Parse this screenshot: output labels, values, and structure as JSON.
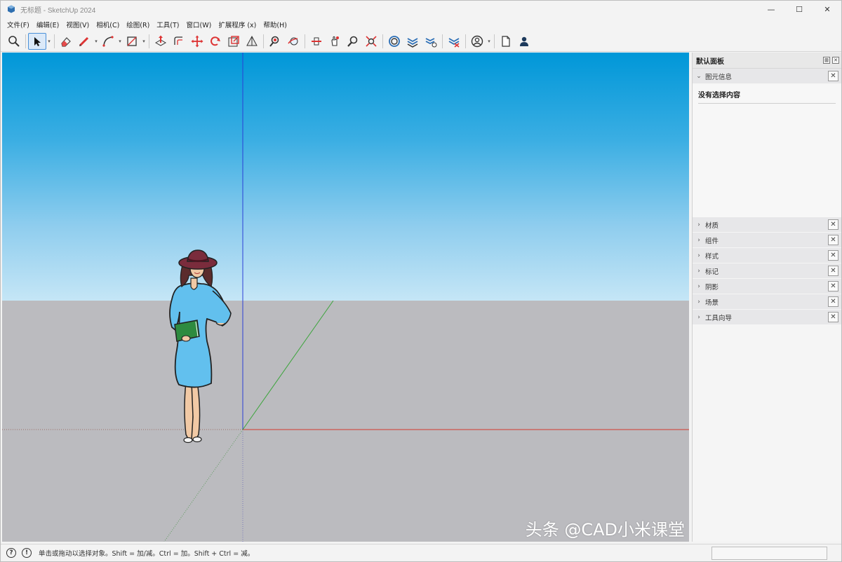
{
  "window": {
    "title": "无标题 - SketchUp 2024",
    "minimize_glyph": "—",
    "maximize_glyph": "☐",
    "close_glyph": "✕"
  },
  "menu": {
    "items": [
      "文件(F)",
      "编辑(E)",
      "视图(V)",
      "相机(C)",
      "绘图(R)",
      "工具(T)",
      "窗口(W)",
      "扩展程序 (x)",
      "帮助(H)"
    ]
  },
  "toolbar": {
    "tools": [
      {
        "name": "search-tool",
        "icon": "magnifier-icon"
      },
      {
        "name": "select-tool",
        "icon": "arrow-cursor-icon",
        "active": true
      },
      {
        "name": "eraser-tool",
        "icon": "eraser-icon"
      },
      {
        "name": "pencil-tool",
        "icon": "pencil-icon"
      },
      {
        "name": "arc-tool",
        "icon": "arc-icon"
      },
      {
        "name": "rectangle-tool",
        "icon": "rectangle-icon"
      },
      {
        "name": "push-pull-tool",
        "icon": "push-pull-icon"
      },
      {
        "name": "offset-tool",
        "icon": "offset-icon"
      },
      {
        "name": "move-tool",
        "icon": "move-icon"
      },
      {
        "name": "rotate-tool",
        "icon": "rotate-icon"
      },
      {
        "name": "scale-tool",
        "icon": "scale-icon"
      },
      {
        "name": "tape-measure-tool",
        "icon": "tape-icon"
      },
      {
        "name": "paint-bucket-tool",
        "icon": "paint-bucket-icon"
      },
      {
        "name": "orbit-tool",
        "icon": "orbit-icon"
      },
      {
        "name": "pan-tool",
        "icon": "pan-icon"
      },
      {
        "name": "zoom-tool",
        "icon": "zoom-icon"
      },
      {
        "name": "zoom-extents-tool",
        "icon": "zoom-extents-icon"
      },
      {
        "name": "warehouse-button",
        "icon": "warehouse-icon"
      },
      {
        "name": "extension-button-1",
        "icon": "layers-icon"
      },
      {
        "name": "extension-button-2",
        "icon": "layers-share-icon"
      },
      {
        "name": "extension-button-3",
        "icon": "layers-x-icon"
      },
      {
        "name": "account-button",
        "icon": "user-circle-icon"
      },
      {
        "name": "new-file-button",
        "icon": "document-icon"
      },
      {
        "name": "profile-button",
        "icon": "person-icon"
      }
    ]
  },
  "panel": {
    "title": "默认面板",
    "entity_info": {
      "label": "图元信息",
      "empty_text": "没有选择内容"
    },
    "sections": [
      "材质",
      "组件",
      "样式",
      "标记",
      "阴影",
      "场景",
      "工具向导"
    ]
  },
  "status": {
    "hint": "单击或拖动以选择对象。Shift = 加/减。Ctrl = 加。Shift + Ctrl = 减。"
  },
  "watermark": "头条 @CAD小米课堂",
  "colors": {
    "sky_top": "#0097d8",
    "sky_bottom": "#c5e6f6",
    "ground": "#bbbbbf",
    "x_axis": "#d33a2c",
    "y_axis": "#3aa43a",
    "z_axis": "#2b3fd6"
  }
}
